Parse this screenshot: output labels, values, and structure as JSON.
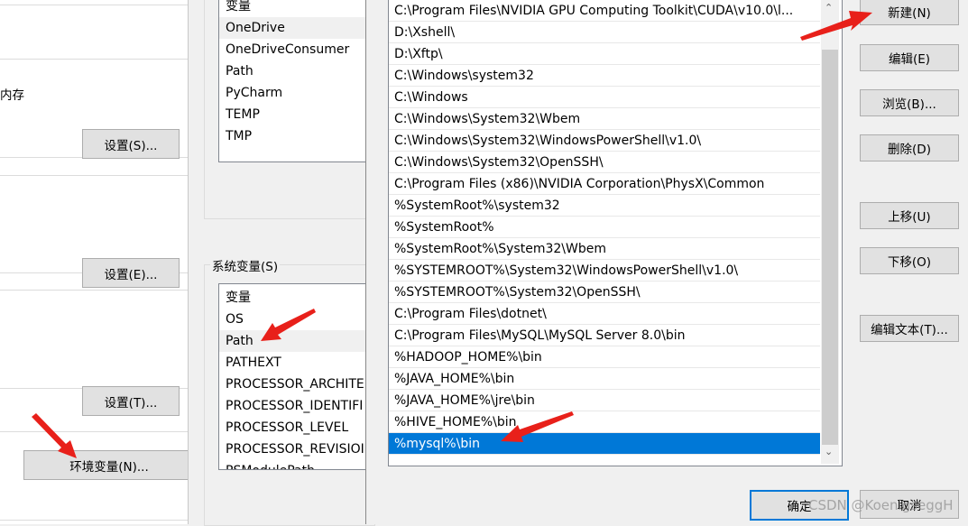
{
  "left_panel": {
    "partial_text": "内存",
    "buttons": [
      "设置(S)...",
      "设置(E)...",
      "设置(T)..."
    ],
    "env_button": "环境变量(N)..."
  },
  "user_vars": {
    "header": "变量",
    "items": [
      "OneDrive",
      "OneDriveConsumer",
      "Path",
      "PyCharm",
      "TEMP",
      "TMP"
    ],
    "selected": "OneDrive"
  },
  "system_vars": {
    "group_label": "系统变量(S)",
    "header": "变量",
    "items": [
      "OS",
      "Path",
      "PATHEXT",
      "PROCESSOR_ARCHITE",
      "PROCESSOR_IDENTIFI",
      "PROCESSOR_LEVEL",
      "PROCESSOR_REVISIOI",
      "PSModulePath"
    ],
    "selected": "Path"
  },
  "path_editor": {
    "entries": [
      "C:\\Program Files\\NVIDIA GPU Computing Toolkit\\CUDA\\v10.0\\l...",
      "D:\\Xshell\\",
      "D:\\Xftp\\",
      "C:\\Windows\\system32",
      "C:\\Windows",
      "C:\\Windows\\System32\\Wbem",
      "C:\\Windows\\System32\\WindowsPowerShell\\v1.0\\",
      "C:\\Windows\\System32\\OpenSSH\\",
      "C:\\Program Files (x86)\\NVIDIA Corporation\\PhysX\\Common",
      "%SystemRoot%\\system32",
      "%SystemRoot%",
      "%SystemRoot%\\System32\\Wbem",
      "%SYSTEMROOT%\\System32\\WindowsPowerShell\\v1.0\\",
      "%SYSTEMROOT%\\System32\\OpenSSH\\",
      "C:\\Program Files\\dotnet\\",
      "C:\\Program Files\\MySQL\\MySQL Server 8.0\\bin",
      "%HADOOP_HOME%\\bin",
      "%JAVA_HOME%\\bin",
      "%JAVA_HOME%\\jre\\bin",
      "%HIVE_HOME%\\bin",
      "%mysql%\\bin"
    ],
    "selected": "%mysql%\\bin",
    "buttons": {
      "new": "新建(N)",
      "edit": "编辑(E)",
      "browse": "浏览(B)...",
      "delete": "删除(D)",
      "move_up": "上移(U)",
      "move_down": "下移(O)",
      "edit_text": "编辑文本(T)..."
    },
    "ok": "确定",
    "cancel": "取消"
  },
  "watermark": "CSDN @KoenigseggH",
  "colors": {
    "selection": "#0078d7",
    "arrow": "#e8201a"
  }
}
